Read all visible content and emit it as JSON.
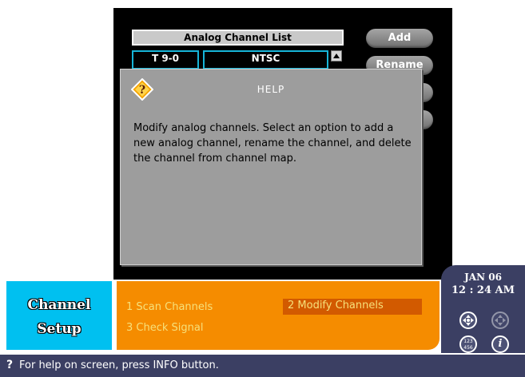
{
  "channel_list": {
    "header": "Analog Channel List",
    "rows": [
      {
        "number": "T 9-0",
        "format": "NTSC"
      }
    ]
  },
  "actions": {
    "add_label": "Add",
    "rename_label": "Rename"
  },
  "help": {
    "title": "HELP",
    "body": "Modify analog channels. Select an option to add a new analog channel, rename the channel, and delete the channel from channel map.",
    "icon": "question-diamond-icon"
  },
  "section": {
    "line1": "Channel",
    "line2": "Setup"
  },
  "menu": {
    "items": [
      {
        "label": "1 Scan Channels",
        "selected": false
      },
      {
        "label": "2 Modify Channels",
        "selected": true
      },
      {
        "label": "3 Check Signal",
        "selected": false
      }
    ]
  },
  "clock": {
    "date": "JAN 06",
    "time": "12 : 24 AM"
  },
  "remote_buttons": {
    "number_pad": "123\n456",
    "info": "i"
  },
  "status": {
    "icon": "?",
    "text": "For help on screen, press INFO button."
  },
  "colors": {
    "accent_orange": "#f58c00",
    "selected_orange": "#d25a00",
    "cyan": "#00c0f0",
    "navy": "#3b3f63",
    "help_gray": "#9d9d9d"
  }
}
